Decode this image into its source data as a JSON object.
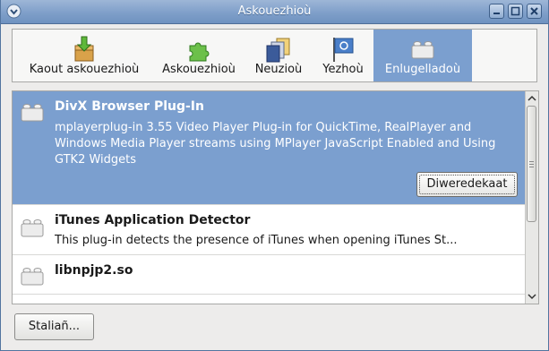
{
  "window": {
    "title": "Askouezhioù"
  },
  "tabs": [
    {
      "label": "Kaout askouezhioù",
      "icon": "get-addons-icon"
    },
    {
      "label": "Askouezhioù",
      "icon": "puzzle-extension-icon"
    },
    {
      "label": "Neuzioù",
      "icon": "themes-icon"
    },
    {
      "label": "Yezhoù",
      "icon": "languages-flag-icon"
    },
    {
      "label": "Enlugelladoù",
      "icon": "plugin-brick-icon"
    }
  ],
  "plugins": [
    {
      "name": "DivX Browser Plug-In",
      "description": "mplayerplug-in 3.55 Video Player Plug-in for QuickTime, RealPlayer and Windows Media Player streams using MPlayer JavaScript Enabled and Using GTK2 Widgets"
    },
    {
      "name": "iTunes Application Detector",
      "description": "This plug-in detects the presence of iTunes when opening iTunes St..."
    },
    {
      "name": "libnpjp2.so",
      "description": ""
    }
  ],
  "buttons": {
    "disable_label": "Diweredekaat",
    "settings_label": "Staliañ..."
  },
  "colors": {
    "selection": "#7b9fcf",
    "titlebar": "#7f9fc9"
  }
}
